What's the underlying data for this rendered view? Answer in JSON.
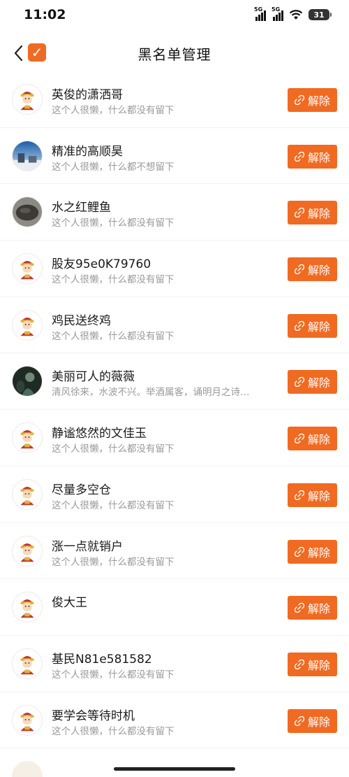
{
  "status": {
    "time": "11:02",
    "sim1": "5G",
    "sim2": "5G",
    "battery": "31"
  },
  "nav": {
    "title": "黑名单管理"
  },
  "unblock_label": "解除",
  "users": [
    {
      "name": "英俊的潇洒哥",
      "desc": "这个人很懒，什么都没有留下",
      "avatar": "caishen"
    },
    {
      "name": "精准的高顺昊",
      "desc": "这个人很懒，什么都不想留下",
      "avatar": "photo-sky"
    },
    {
      "name": "水之红鲤鱼",
      "desc": "这个人很懒，什么都没有留下",
      "avatar": "photo-stone"
    },
    {
      "name": "股友95e0K79760",
      "desc": "这个人很懒，什么都没有留下",
      "avatar": "caishen"
    },
    {
      "name": "鸡民送终鸡",
      "desc": "这个人很懒，什么都没有留下",
      "avatar": "caishen"
    },
    {
      "name": "美丽可人的薇薇",
      "desc": "清风徐来，水波不兴。举酒属客，诵明月之诗…",
      "avatar": "photo-dark"
    },
    {
      "name": "静谧悠然的文佳玉",
      "desc": "这个人很懒，什么都没有留下",
      "avatar": "caishen"
    },
    {
      "name": "尽量多空仓",
      "desc": "这个人很懒，什么都没有留下",
      "avatar": "caishen"
    },
    {
      "name": "涨一点就销户",
      "desc": "这个人很懒，什么都没有留下",
      "avatar": "caishen"
    },
    {
      "name": "俊大王",
      "desc": "",
      "avatar": "caishen"
    },
    {
      "name": "基民N81e581582",
      "desc": "这个人很懒，什么都没有留下",
      "avatar": "caishen"
    },
    {
      "name": "要学会等待时机",
      "desc": "这个人很懒，什么都没有留下",
      "avatar": "caishen"
    }
  ],
  "colors": {
    "accent": "#f06a22",
    "text": "#1a1a1a",
    "subtext": "#9a9a9a"
  }
}
